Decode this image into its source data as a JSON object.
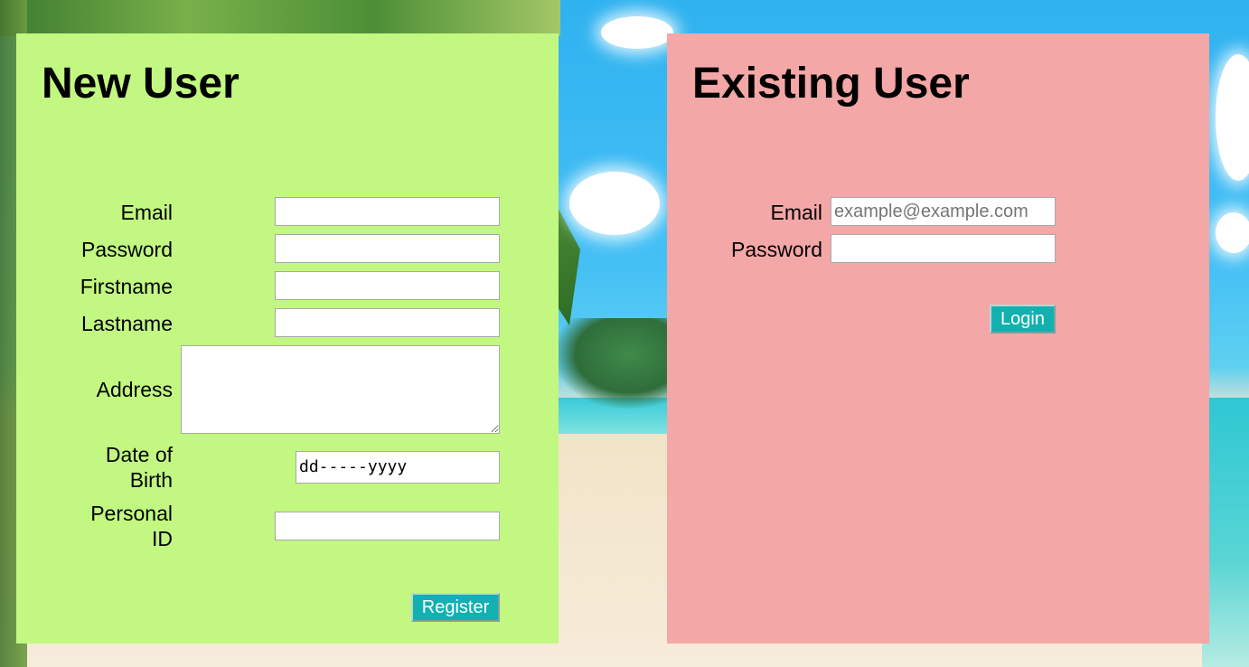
{
  "new_user": {
    "title": "New User",
    "fields": {
      "email_label": "Email",
      "password_label": "Password",
      "firstname_label": "Firstname",
      "lastname_label": "Lastname",
      "address_label": "Address",
      "dob_label_line1": "Date of",
      "dob_label_line2": "Birth",
      "dob_value": "dd-----yyyy",
      "personal_id_label_line1": "Personal",
      "personal_id_label_line2": "ID"
    },
    "register_button": "Register",
    "background_color": "#c2f782"
  },
  "existing_user": {
    "title": "Existing User",
    "email_label": "Email",
    "email_placeholder": "example@example.com",
    "password_label": "Password",
    "login_button": "Login",
    "background_color": "#f4a7a7"
  },
  "accent_color": "#13b0b0"
}
